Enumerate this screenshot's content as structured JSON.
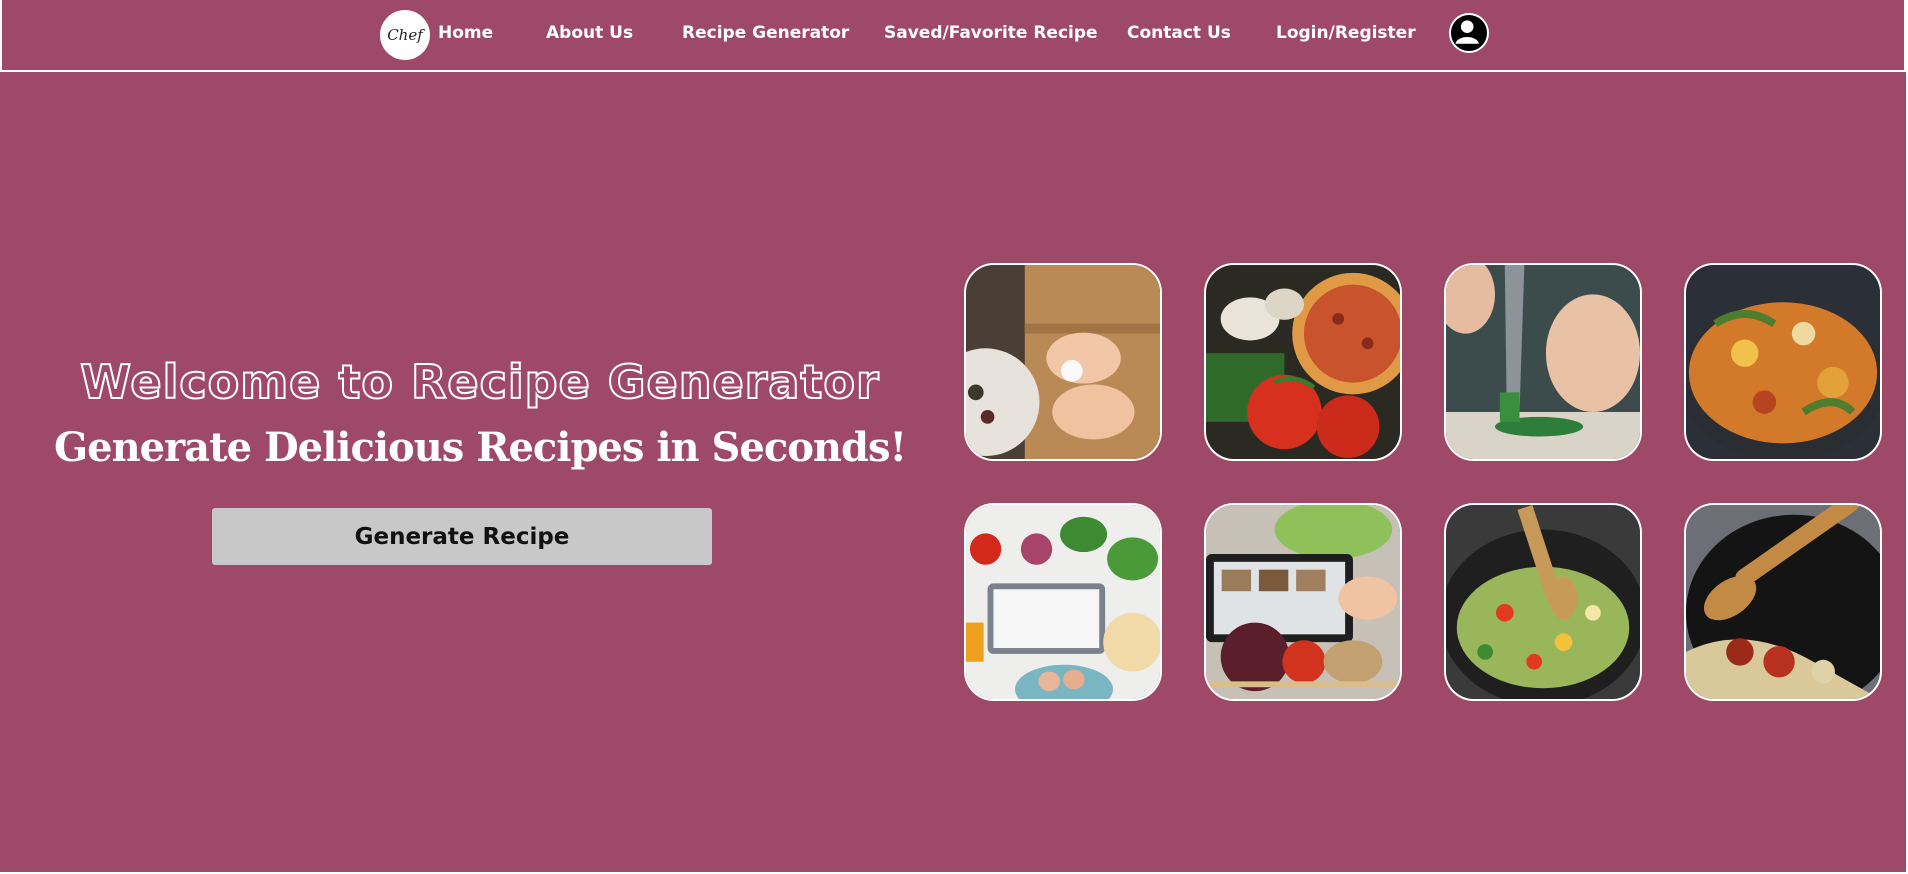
{
  "nav": {
    "logo_text": "Chef",
    "items": [
      {
        "label": "Home"
      },
      {
        "label": "About Us"
      },
      {
        "label": "Recipe Generator"
      },
      {
        "label": "Saved/Favorite Recipe"
      },
      {
        "label": "Contact Us"
      },
      {
        "label": "Login/Register"
      }
    ],
    "profile_icon": "user-icon"
  },
  "hero": {
    "title": "Welcome to Recipe Generator",
    "subtitle": "Generate Delicious Recipes in Seconds!",
    "button_label": "Generate Recipe"
  },
  "gallery": [
    {
      "name": "hands-shaping-dough"
    },
    {
      "name": "pizza-tomatoes-mushrooms"
    },
    {
      "name": "knife-chopping-greens"
    },
    {
      "name": "stir-fry-pan"
    },
    {
      "name": "vegetables-tablet-eggs"
    },
    {
      "name": "tablet-recipe-vegetables"
    },
    {
      "name": "wok-vegetables-spoon"
    },
    {
      "name": "pan-spices-spoon"
    }
  ],
  "colors": {
    "background": "#9f4968",
    "button": "#c8c8c8",
    "text": "#ffffff"
  }
}
